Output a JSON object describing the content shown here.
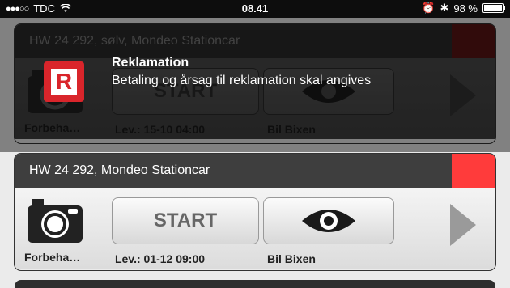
{
  "status_bar": {
    "carrier": "TDC",
    "time": "08.41",
    "battery": "98 %",
    "battery_level": 0.98
  },
  "notification": {
    "icon_letter": "R",
    "title": "Reklamation",
    "message": "Betaling og årsag til reklamation skal angives"
  },
  "cards": [
    {
      "title": "HW 24 292, sølv, Mondeo Stationcar",
      "camera_label": "Forbeha…",
      "start_label": "START",
      "delivery_label": "Lev.: 15-10 04:00",
      "view_label": "Bil Bixen",
      "tag_color": "#5a1414"
    },
    {
      "title": "HW 24 292, Mondeo Stationcar",
      "camera_label": "Forbeha…",
      "start_label": "START",
      "delivery_label": "Lev.: 01-12 09:00",
      "view_label": "Bil Bixen",
      "tag_color": "#ff3b3b"
    }
  ]
}
